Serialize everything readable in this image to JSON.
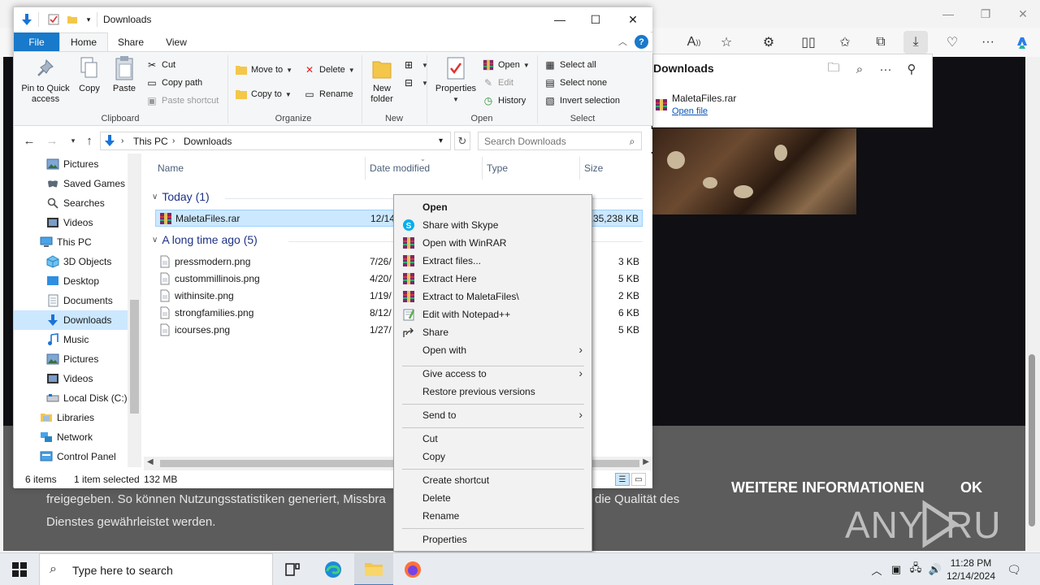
{
  "browser": {
    "downloads_panel": {
      "title": "Downloads",
      "file_name": "MaletaFiles.rar",
      "open_link": "Open file"
    },
    "cookie_banner": {
      "line1": "freigegeben. So können Nutzungsstatistiken generiert, Missbra",
      "line1_end": "die Qualität des",
      "line2": "Dienstes gewährleistet werden.",
      "more_info": "WEITERE INFORMATIONEN",
      "ok": "OK"
    },
    "watermark": "ANY RUN"
  },
  "explorer": {
    "title": "Downloads",
    "tabs": [
      "File",
      "Home",
      "Share",
      "View"
    ],
    "ribbon": {
      "clipboard": {
        "pin": "Pin to Quick access",
        "copy": "Copy",
        "paste": "Paste",
        "cut": "Cut",
        "copy_path": "Copy path",
        "paste_shortcut": "Paste shortcut",
        "label": "Clipboard"
      },
      "organize": {
        "move_to": "Move to",
        "copy_to": "Copy to",
        "delete": "Delete",
        "rename": "Rename",
        "label": "Organize"
      },
      "new": {
        "new_folder": "New folder",
        "label": "New"
      },
      "open": {
        "properties": "Properties",
        "open": "Open",
        "edit": "Edit",
        "history": "History",
        "label": "Open"
      },
      "select": {
        "select_all": "Select all",
        "select_none": "Select none",
        "invert": "Invert selection",
        "label": "Select"
      }
    },
    "address": {
      "crumbs": [
        "This PC",
        "Downloads"
      ],
      "search_placeholder": "Search Downloads"
    },
    "nav_items": [
      {
        "label": "Pictures",
        "icon": "pictures"
      },
      {
        "label": "Saved Games",
        "icon": "saved-games"
      },
      {
        "label": "Searches",
        "icon": "searches"
      },
      {
        "label": "Videos",
        "icon": "videos"
      },
      {
        "label": "This PC",
        "icon": "this-pc"
      },
      {
        "label": "3D Objects",
        "icon": "3d-objects"
      },
      {
        "label": "Desktop",
        "icon": "desktop"
      },
      {
        "label": "Documents",
        "icon": "documents"
      },
      {
        "label": "Downloads",
        "icon": "downloads"
      },
      {
        "label": "Music",
        "icon": "music"
      },
      {
        "label": "Pictures",
        "icon": "pictures"
      },
      {
        "label": "Videos",
        "icon": "videos"
      },
      {
        "label": "Local Disk (C:)",
        "icon": "local-disk"
      },
      {
        "label": "Libraries",
        "icon": "libraries"
      },
      {
        "label": "Network",
        "icon": "network"
      },
      {
        "label": "Control Panel",
        "icon": "control-panel"
      }
    ],
    "columns": {
      "name": "Name",
      "date": "Date modified",
      "type": "Type",
      "size": "Size"
    },
    "groups": {
      "today": "Today (1)",
      "long_ago": "A long time ago (5)"
    },
    "today_files": [
      {
        "name": "MaletaFiles.rar",
        "date": "12/14",
        "size": "135,238 KB"
      }
    ],
    "old_files": [
      {
        "name": "pressmodern.png",
        "date": "7/26/",
        "size": "3 KB"
      },
      {
        "name": "custommillinois.png",
        "date": "4/20/",
        "size": "5 KB"
      },
      {
        "name": "withinsite.png",
        "date": "1/19/",
        "size": "2 KB"
      },
      {
        "name": "strongfamilies.png",
        "date": "8/12/",
        "size": "6 KB"
      },
      {
        "name": "icourses.png",
        "date": "1/27/",
        "size": "5 KB"
      }
    ],
    "status": {
      "items": "6 items",
      "selected": "1 item selected",
      "size": "132 MB"
    }
  },
  "context_menu": {
    "open": "Open",
    "share_skype": "Share with Skype",
    "open_winrar": "Open with WinRAR",
    "extract_files": "Extract files...",
    "extract_here": "Extract Here",
    "extract_to": "Extract to MaletaFiles\\",
    "edit_notepad": "Edit with Notepad++",
    "share": "Share",
    "open_with": "Open with",
    "give_access": "Give access to",
    "restore": "Restore previous versions",
    "send_to": "Send to",
    "cut": "Cut",
    "copy": "Copy",
    "create_shortcut": "Create shortcut",
    "delete": "Delete",
    "rename": "Rename",
    "properties": "Properties"
  },
  "taskbar": {
    "search_placeholder": "Type here to search",
    "time": "11:28 PM",
    "date": "12/14/2024"
  },
  "colors": {
    "accent": "#1979ca",
    "selection": "#cce8ff",
    "cookie_bg": "#5c5c5c"
  }
}
